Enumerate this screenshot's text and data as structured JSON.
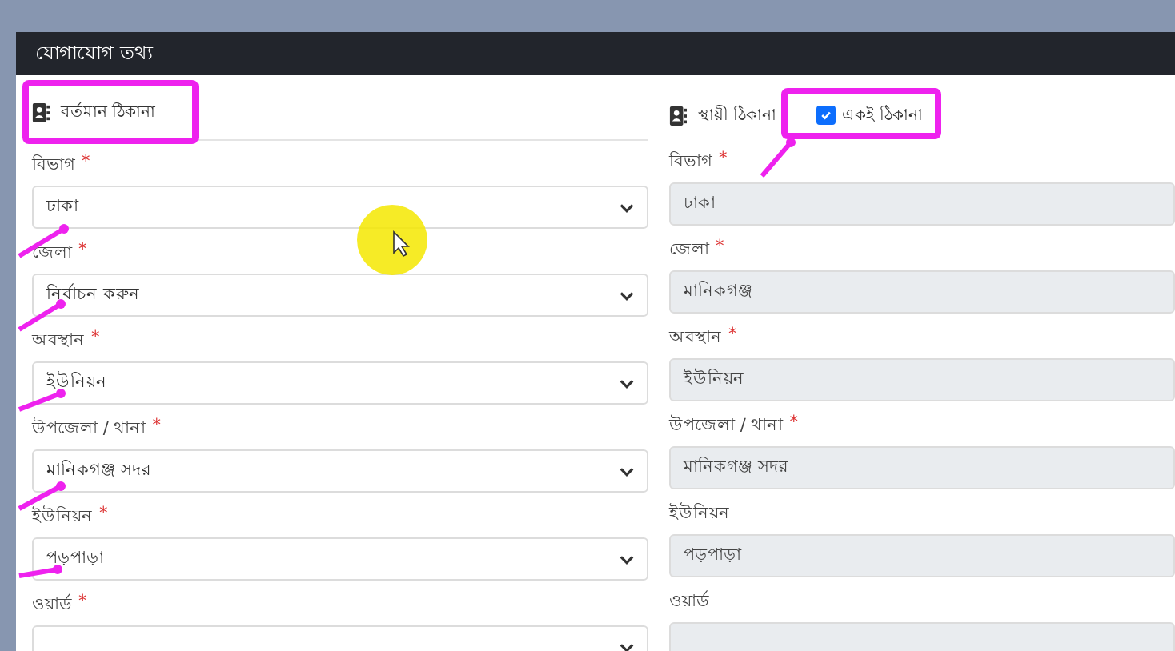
{
  "header": {
    "title": "যোগাযোগ তথ্য"
  },
  "present_address": {
    "heading": "বর্তমান ঠিকানা",
    "fields": [
      {
        "label": "বিভাগ",
        "required_mark": "*",
        "value": "ঢাকা",
        "disabled": false
      },
      {
        "label": "জেলা",
        "required_mark": "*",
        "value": "নির্বাচন করুন",
        "disabled": false
      },
      {
        "label": "অবস্থান",
        "required_mark": "*",
        "value": "ইউনিয়ন",
        "disabled": false
      },
      {
        "label": "উপজেলা / থানা",
        "required_mark": "*",
        "value": "মানিকগঞ্জ সদর",
        "disabled": false
      },
      {
        "label": "ইউনিয়ন",
        "required_mark": "*",
        "value": "পড়পাড়া",
        "disabled": false
      },
      {
        "label": "ওয়ার্ড",
        "required_mark": "*",
        "disabled": false
      }
    ]
  },
  "permanent_address": {
    "heading": "স্থায়ী ঠিকানা",
    "same_address": {
      "label": "একই ঠিকানা",
      "checked": true
    },
    "fields": [
      {
        "label": "বিভাগ",
        "required_mark": "*",
        "value": "ঢাকা",
        "disabled": true
      },
      {
        "label": "জেলা",
        "required_mark": "*",
        "value": "মানিকগঞ্জ",
        "disabled": true
      },
      {
        "label": "অবস্থান",
        "required_mark": "*",
        "value": "ইউনিয়ন",
        "disabled": true
      },
      {
        "label": "উপজেলা / থানা",
        "required_mark": "*",
        "value": "মানিকগঞ্জ সদর",
        "disabled": true
      },
      {
        "label": "ইউনিয়ন",
        "value": "পড়পাড়া",
        "disabled": true
      },
      {
        "label": "ওয়ার্ড",
        "disabled": true
      }
    ]
  }
}
